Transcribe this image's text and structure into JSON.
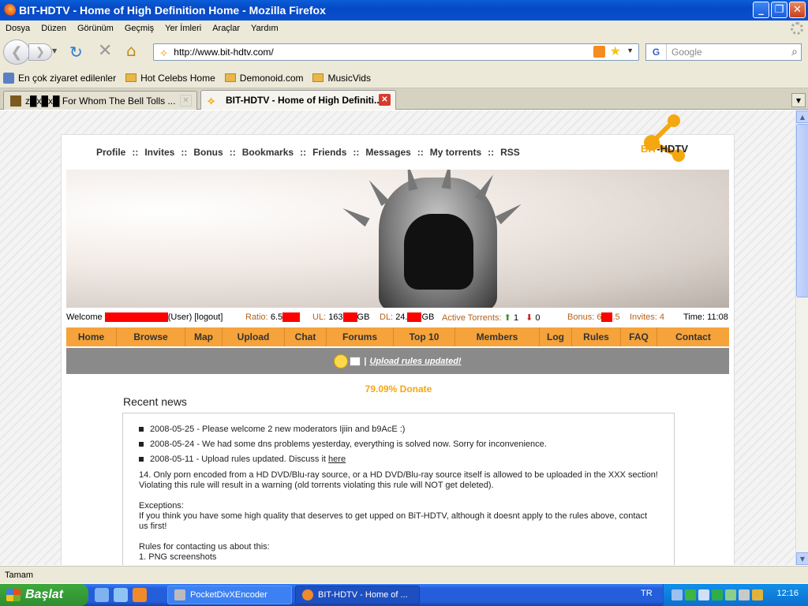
{
  "window": {
    "title": "BIT-HDTV - Home of High Definition Home - Mozilla Firefox"
  },
  "menu": [
    "Dosya",
    "Düzen",
    "Görünüm",
    "Geçmiş",
    "Yer İmleri",
    "Araçlar",
    "Yardım"
  ],
  "address": {
    "url": "http://www.bit-hdtv.com/"
  },
  "search": {
    "placeholder": "Google",
    "engine": "G"
  },
  "bookmarks": [
    "En çok ziyaret edilenler",
    "Hot Celebs Home",
    "Demonoid.com",
    "MusicVids"
  ],
  "tabs": [
    {
      "label": "z█x█x█ For Whom The Bell Tolls ..."
    },
    {
      "label": "BIT-HDTV - Home of High Definiti..."
    }
  ],
  "site": {
    "topnav": [
      "Profile",
      "Invites",
      "Bonus",
      "Bookmarks",
      "Friends",
      "Messages",
      "My torrents",
      "RSS"
    ],
    "topnav_sep": "::",
    "logo_part1": "BIT",
    "logo_part2": "-HDTV",
    "stats": {
      "welcome": "Welcome",
      "user_role": "(User) [logout]",
      "ratio_label": "Ratio:",
      "ratio_value": "6.5",
      "ul_label": "UL:",
      "ul_value": "163",
      "ul_unit": "GB",
      "dl_label": "DL:",
      "dl_value": "24.",
      "dl_unit": "GB",
      "active_label": "Active Torrents:",
      "active_up": "1",
      "active_down": "0",
      "bonus_label": "Bonus:",
      "bonus_pre": "6",
      "bonus_post": ".5",
      "invites_label": "Invites: 4",
      "time_label": "Time: 11:08"
    },
    "mainnav": [
      "Home",
      "Browse",
      "Map",
      "Upload",
      "Chat",
      "Forums",
      "Top 10",
      "Members",
      "Log",
      "Rules",
      "FAQ",
      "Contact"
    ],
    "notice": {
      "sep": "|",
      "link": "Upload rules updated!"
    },
    "donate": "79.09% Donate",
    "news_title": "Recent news",
    "news": [
      "2008-05-25 - Please welcome 2 new moderators Ijiin and b9AcE :)",
      "2008-05-24 - We had some dns problems yesterday, everything is solved now. Sorry for inconvenience.",
      "2008-05-11 - Upload rules updated. Discuss it"
    ],
    "news_link": "here",
    "rules_14a": "14. Only porn encoded from a HD DVD/Blu-ray source, or a HD DVD/Blu-ray source itself is allowed to be uploaded in the XXX section!",
    "rules_14b": "Violating this rule will result in a warning (old torrents violating this rule will NOT get deleted).",
    "exceptions_title": "Exceptions:",
    "exceptions_text": "If you think you have some high quality that deserves to get upped on BiT-HDTV, although it doesnt apply to the rules above, contact us first!",
    "contact_title": "Rules for contacting us about this:",
    "contact_item1": "1.  PNG screenshots"
  },
  "status": "Tamam",
  "taskbar": {
    "start": "Başlat",
    "tasks": [
      "PocketDivXEncoder",
      "BIT-HDTV - Home of ..."
    ],
    "lang": "TR",
    "clock": "12:16"
  },
  "colors": {
    "accent_orange": "#f5a33a",
    "title_blue": "#0a5ed7",
    "logo_orange": "#f5a70f",
    "redaction": "#ff0000"
  }
}
